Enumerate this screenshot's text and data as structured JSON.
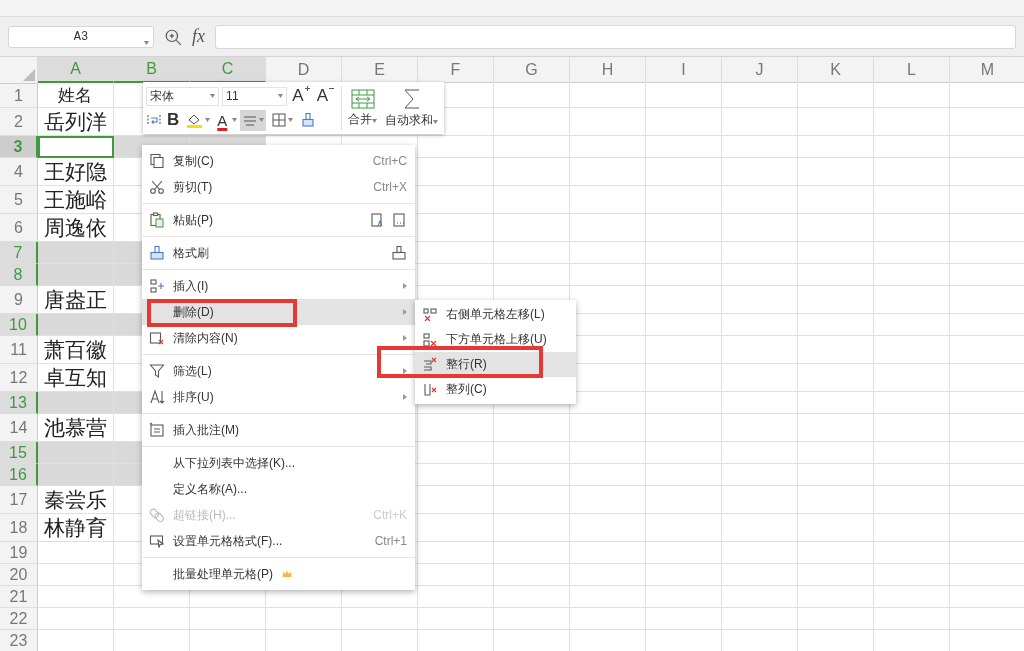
{
  "formula_bar": {
    "name_box": "A3",
    "fx": "fx"
  },
  "sheet": {
    "columns": [
      {
        "label": "A",
        "selected": true
      },
      {
        "label": "B",
        "selected": true
      },
      {
        "label": "C",
        "selected": true
      },
      {
        "label": "D",
        "selected": false
      },
      {
        "label": "E",
        "selected": false
      },
      {
        "label": "F",
        "selected": false
      },
      {
        "label": "G",
        "selected": false
      },
      {
        "label": "H",
        "selected": false
      },
      {
        "label": "I",
        "selected": false
      },
      {
        "label": "J",
        "selected": false
      },
      {
        "label": "K",
        "selected": false
      },
      {
        "label": "L",
        "selected": false
      },
      {
        "label": "M",
        "selected": false
      }
    ],
    "rows": [
      {
        "number": "1",
        "selected": false,
        "active": false,
        "cell_a": "姓名"
      },
      {
        "number": "2",
        "selected": false,
        "active": false,
        "cell_a": "岳列洋"
      },
      {
        "number": "3",
        "selected": true,
        "active": true
      },
      {
        "number": "4",
        "selected": false,
        "active": false,
        "cell_a": "王好隐"
      },
      {
        "number": "5",
        "selected": false,
        "active": false,
        "cell_a": "王施峪"
      },
      {
        "number": "6",
        "selected": false,
        "active": false,
        "cell_a": "周逸依"
      },
      {
        "number": "7",
        "selected": true,
        "active": false
      },
      {
        "number": "8",
        "selected": true,
        "active": false
      },
      {
        "number": "9",
        "selected": false,
        "active": false,
        "cell_a": "唐盎正"
      },
      {
        "number": "10",
        "selected": true,
        "active": false
      },
      {
        "number": "11",
        "selected": false,
        "active": false,
        "cell_a": "萧百徽"
      },
      {
        "number": "12",
        "selected": false,
        "active": false,
        "cell_a": "卓互知"
      },
      {
        "number": "13",
        "selected": true,
        "active": false
      },
      {
        "number": "14",
        "selected": false,
        "active": false,
        "cell_a": "池慕营"
      },
      {
        "number": "15",
        "selected": true,
        "active": false
      },
      {
        "number": "16",
        "selected": true,
        "active": false
      },
      {
        "number": "17",
        "selected": false,
        "active": false,
        "cell_a": "秦尝乐"
      },
      {
        "number": "18",
        "selected": false,
        "active": false,
        "cell_a": "林静育"
      },
      {
        "number": "19",
        "selected": false,
        "active": false
      },
      {
        "number": "20",
        "selected": false,
        "active": false
      },
      {
        "number": "21",
        "selected": false,
        "active": false
      },
      {
        "number": "22",
        "selected": false,
        "active": false
      },
      {
        "number": "23",
        "selected": false,
        "active": false
      }
    ]
  },
  "mini_toolbar": {
    "font": "宋体",
    "size": "11",
    "grow_font": "A",
    "shrink_font": "A",
    "bold": "B",
    "font_color": "A",
    "align_pressed": true,
    "merge": "合并",
    "autosum": "自动求和"
  },
  "context_menu": {
    "items": [
      {
        "kind": "item",
        "label": "复制(C)",
        "shortcut": "Ctrl+C",
        "submenu": false,
        "disabled": false,
        "selected": false
      },
      {
        "kind": "item",
        "label": "剪切(T)",
        "shortcut": "Ctrl+X",
        "submenu": false,
        "disabled": false,
        "selected": false
      },
      {
        "kind": "separator"
      },
      {
        "kind": "item",
        "label": "粘贴(P)",
        "submenu": false,
        "disabled": false,
        "selected": false
      },
      {
        "kind": "separator"
      },
      {
        "kind": "item",
        "label": "格式刷",
        "submenu": false,
        "disabled": false,
        "selected": false
      },
      {
        "kind": "separator"
      },
      {
        "kind": "item",
        "label": "插入(I)",
        "submenu": true,
        "disabled": false,
        "selected": false
      },
      {
        "kind": "item",
        "label": "删除(D)",
        "submenu": true,
        "disabled": false,
        "selected": true
      },
      {
        "kind": "item",
        "label": "清除内容(N)",
        "submenu": true,
        "disabled": false,
        "selected": false
      },
      {
        "kind": "separator"
      },
      {
        "kind": "item",
        "label": "筛选(L)",
        "submenu": true,
        "disabled": false,
        "selected": false
      },
      {
        "kind": "item",
        "label": "排序(U)",
        "submenu": true,
        "disabled": false,
        "selected": false
      },
      {
        "kind": "separator"
      },
      {
        "kind": "item",
        "label": "插入批注(M)",
        "submenu": false,
        "disabled": false,
        "selected": false
      },
      {
        "kind": "separator"
      },
      {
        "kind": "item",
        "label": "从下拉列表中选择(K)...",
        "submenu": false,
        "disabled": false,
        "selected": false
      },
      {
        "kind": "item",
        "label": "定义名称(A)...",
        "submenu": false,
        "disabled": false,
        "selected": false
      },
      {
        "kind": "item",
        "label": "超链接(H)...",
        "shortcut": "Ctrl+K",
        "submenu": false,
        "disabled": true,
        "selected": false
      },
      {
        "kind": "item",
        "label": "设置单元格格式(F)...",
        "shortcut": "Ctrl+1",
        "submenu": false,
        "disabled": false,
        "selected": false
      },
      {
        "kind": "separator"
      },
      {
        "kind": "item",
        "label": "批量处理单元格(P)",
        "submenu": false,
        "disabled": false,
        "selected": false
      }
    ]
  },
  "submenu": {
    "items": [
      {
        "label": "右侧单元格左移(L)",
        "selected": false
      },
      {
        "label": "下方单元格上移(U)",
        "selected": false
      },
      {
        "label": "整行(R)",
        "selected": true
      },
      {
        "label": "整列(C)",
        "selected": false
      }
    ]
  }
}
